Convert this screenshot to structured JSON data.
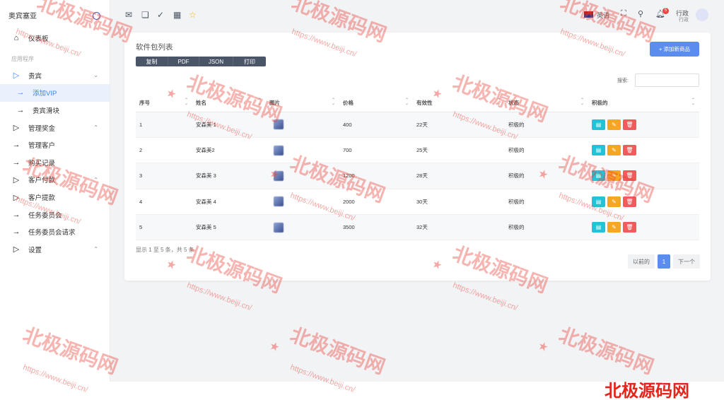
{
  "brand": {
    "name": "奥宾塞亚"
  },
  "sidebar": {
    "dashboard": "仪表板",
    "section": "应用程序",
    "items": [
      {
        "label": "贵宾",
        "type": "group"
      },
      {
        "label": "添加VIP",
        "type": "sub-active"
      },
      {
        "label": "贵宾滑块",
        "type": "sub"
      },
      {
        "label": "管理奖金",
        "type": "group"
      },
      {
        "label": "管理客户",
        "type": "link"
      },
      {
        "label": "购买记录",
        "type": "link"
      },
      {
        "label": "客户付款",
        "type": "group"
      },
      {
        "label": "客户提款",
        "type": "group-plain"
      },
      {
        "label": "任务委员会",
        "type": "link"
      },
      {
        "label": "任务委员会请求",
        "type": "link"
      },
      {
        "label": "设置",
        "type": "group"
      }
    ]
  },
  "topbar": {
    "language": "英语",
    "notification_count": "5",
    "user_name": "行政",
    "user_role": "行政"
  },
  "page": {
    "title": "软件包列表",
    "add_button": "+ 添加新商品",
    "export_buttons": [
      "复制",
      "PDF",
      "JSON",
      "打印"
    ],
    "search_label": "搜索:",
    "search_value": ""
  },
  "table": {
    "headers": [
      "序号",
      "姓名",
      "图片",
      "价格",
      "有效性",
      "状态",
      "积极的"
    ],
    "rows": [
      {
        "no": "1",
        "name": "安森美 1",
        "price": "400",
        "validity": "22天",
        "status": "积极的"
      },
      {
        "no": "2",
        "name": "安森美2",
        "price": "700",
        "validity": "25天",
        "status": "积极的"
      },
      {
        "no": "3",
        "name": "安森美 3",
        "price": "1200",
        "validity": "28天",
        "status": "积极的"
      },
      {
        "no": "4",
        "name": "安森美 4",
        "price": "2000",
        "validity": "30天",
        "status": "积极的"
      },
      {
        "no": "5",
        "name": "安森美 5",
        "price": "3500",
        "validity": "32天",
        "status": "积极的"
      }
    ]
  },
  "footer_info": "显示 1 至 5 条，共 5 条",
  "pagination": {
    "prev": "以前的",
    "current": "1",
    "next": "下一个"
  },
  "watermark": {
    "text": "北极源码网",
    "url": "https://www.beiji.cn/"
  },
  "colors": {
    "accent": "#5b8def",
    "view": "#22c3d6",
    "edit": "#f5a623",
    "delete": "#f05b5b",
    "export": "#4a5568"
  }
}
